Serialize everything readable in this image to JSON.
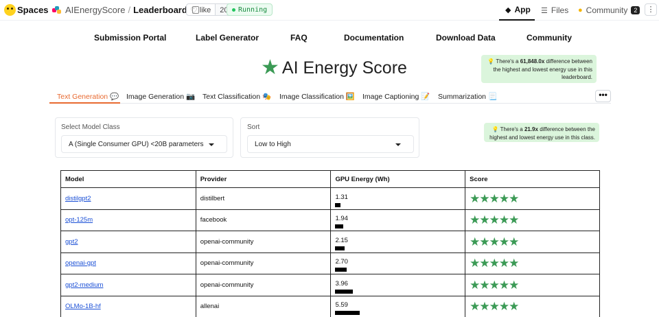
{
  "topbar": {
    "spaces_label": "Spaces",
    "owner": "AIEnergyScore",
    "separator": "/",
    "repo": "Leaderboard",
    "like_label": "like",
    "like_count": "20",
    "status": "Running",
    "tabs": [
      {
        "label": "App",
        "icon": "cube-icon",
        "active": true
      },
      {
        "label": "Files",
        "icon": "files-icon",
        "active": false
      },
      {
        "label": "Community",
        "icon": "community-icon",
        "active": false,
        "badge": "2"
      }
    ],
    "more_glyph": "⋮"
  },
  "nav": [
    "Submission Portal",
    "Label Generator",
    "FAQ",
    "Documentation",
    "Download Data",
    "Community"
  ],
  "title": {
    "icon": "star-icon",
    "text": "AI Energy Score"
  },
  "tip_global": {
    "pre": "💡 There's a ",
    "value": "61,848.0x",
    "post": " difference between the highest and lowest energy use in this leaderboard."
  },
  "tip_class": {
    "pre": "💡 There's a ",
    "value": "21.9x",
    "post": " difference between the highest and lowest energy use in this class."
  },
  "tabs": [
    {
      "label": "Text Generation 💬",
      "active": true
    },
    {
      "label": "Image Generation 📷",
      "active": false
    },
    {
      "label": "Text Classification 🎭",
      "active": false
    },
    {
      "label": "Image Classification 🖼️",
      "active": false
    },
    {
      "label": "Image Captioning 📝",
      "active": false
    },
    {
      "label": "Summarization 📃",
      "active": false
    }
  ],
  "tabs_more_glyph": "•••",
  "model_class": {
    "label": "Select Model Class",
    "value": "A (Single Consumer GPU) <20B parameters"
  },
  "sort": {
    "label": "Sort",
    "value": "Low to High"
  },
  "table": {
    "headers": [
      "Model",
      "Provider",
      "GPU Energy (Wh)",
      "Score"
    ],
    "max_energy_for_bar": 5.59,
    "rows": [
      {
        "model": "distilgpt2",
        "provider": "distilbert",
        "energy": "1.31",
        "energy_value": 1.31,
        "score": "★★★★★"
      },
      {
        "model": "opt-125m",
        "provider": "facebook",
        "energy": "1.94",
        "energy_value": 1.94,
        "score": "★★★★★"
      },
      {
        "model": "gpt2",
        "provider": "openai-community",
        "energy": "2.15",
        "energy_value": 2.15,
        "score": "★★★★★"
      },
      {
        "model": "openai-gpt",
        "provider": "openai-community",
        "energy": "2.70",
        "energy_value": 2.7,
        "score": "★★★★★"
      },
      {
        "model": "gpt2-medium",
        "provider": "openai-community",
        "energy": "3.96",
        "energy_value": 3.96,
        "score": "★★★★★"
      },
      {
        "model": "OLMo-1B-hf",
        "provider": "allenai",
        "energy": "5.59",
        "energy_value": 5.59,
        "score": "★★★★★"
      }
    ]
  },
  "colors": {
    "accent": "#e8692f",
    "star": "#3b9a55",
    "tip_bg": "#dbf5dc",
    "link": "#1a4fd6"
  }
}
